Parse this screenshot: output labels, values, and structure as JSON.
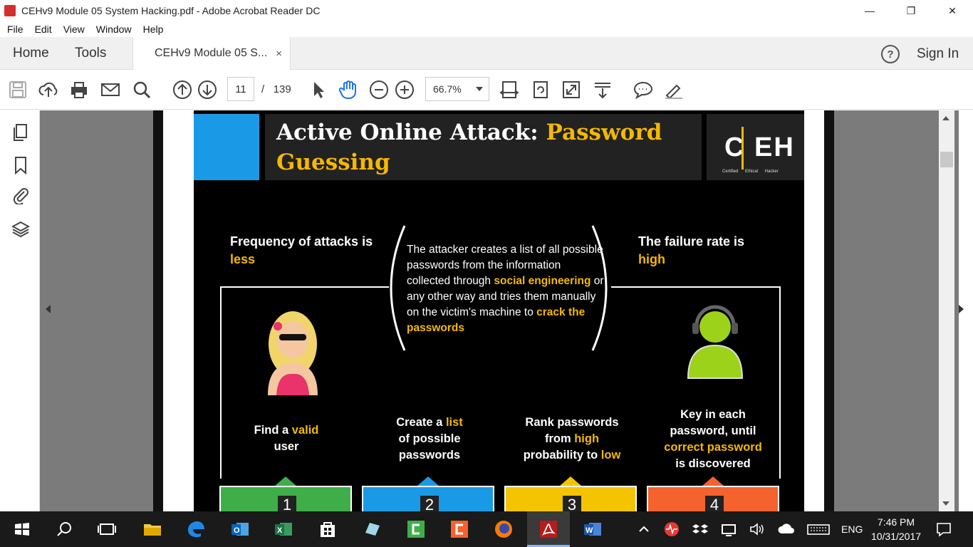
{
  "window": {
    "title": "CEHv9 Module 05 System Hacking.pdf - Adobe Acrobat Reader DC",
    "minimize": "—",
    "restore": "❐",
    "close": "✕"
  },
  "menu": [
    "File",
    "Edit",
    "View",
    "Window",
    "Help"
  ],
  "tabs": {
    "home": "Home",
    "tools": "Tools",
    "doc": "CEHv9 Module 05 S...",
    "doc_close": "×",
    "help": "?",
    "signin": "Sign In"
  },
  "toolbar": {
    "page_current": "11",
    "page_sep": "/",
    "page_total": "139",
    "zoom": "66.7%"
  },
  "slide": {
    "title_white": "Active Online Attack: ",
    "title_yellow1": "Password",
    "title_yellow2": "Guessing",
    "logo": "C EH",
    "logo_sub": "Certified Ethical Hacker",
    "left_heading": "Frequency of attacks is",
    "left_value": "less",
    "right_heading": "The failure rate is",
    "right_value": "high",
    "center_1": "The attacker creates a list of all possible passwords from the information collected through ",
    "center_hl1": "social engineering",
    "center_2": " or any other way and tries them manually on the victim's machine to ",
    "center_hl2": "crack the passwords",
    "steps": [
      {
        "a": "Find a ",
        "b": "valid",
        "c": "user",
        "num": "1",
        "color": "#3fae49"
      },
      {
        "a": "Create a ",
        "b": "list",
        "c": "of possible passwords",
        "num": "2",
        "color": "#1a9ae6"
      },
      {
        "a": "Rank passwords from ",
        "b": "high",
        "c": "probability to ",
        "d": "low",
        "num": "3",
        "color": "#f5c400"
      },
      {
        "a": "Key in each password, until",
        "b": "correct password",
        "c": "is discovered",
        "num": "4",
        "color": "#f4622e"
      }
    ]
  },
  "taskbar": {
    "lang": "ENG",
    "time": "7:46 PM",
    "date": "10/31/2017"
  },
  "colors": {
    "accent_yellow": "#f5b800",
    "blue": "#1a9ae6",
    "green": "#3fae49",
    "orange": "#f4622e"
  }
}
